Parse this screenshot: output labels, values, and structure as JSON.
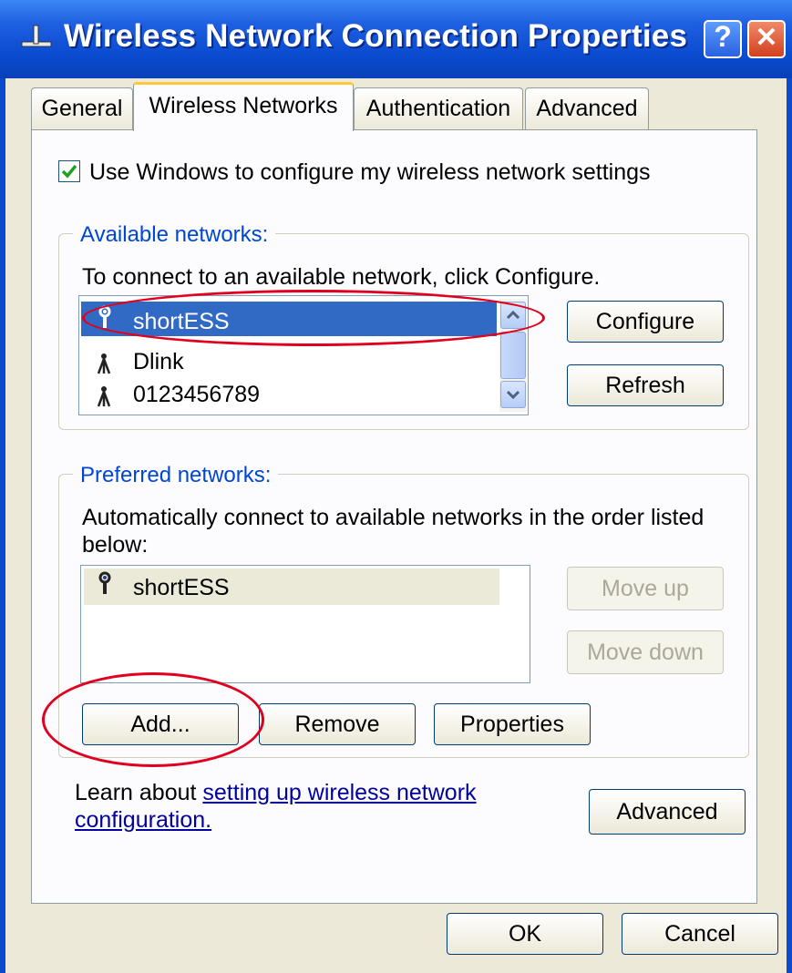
{
  "window": {
    "title": "Wireless Network Connection Properties",
    "help_glyph": "?",
    "close_glyph": "✕"
  },
  "tabs": [
    {
      "label": "General"
    },
    {
      "label": "Wireless Networks",
      "active": true
    },
    {
      "label": "Authentication"
    },
    {
      "label": "Advanced"
    }
  ],
  "use_windows": {
    "label": "Use Windows to configure my wireless network settings",
    "checked": true
  },
  "available": {
    "group_label": "Available networks:",
    "instruction": "To connect to an available network, click Configure.",
    "networks": [
      {
        "name": "shortESS",
        "icon": "wireless-infrastructure-icon",
        "selected": true
      },
      {
        "name": "Dlink",
        "icon": "antenna-icon"
      },
      {
        "name": "0123456789",
        "icon": "antenna-icon"
      }
    ],
    "configure_label": "Configure",
    "refresh_label": "Refresh"
  },
  "preferred": {
    "group_label": "Preferred networks:",
    "instruction_line1": "Automatically connect to available networks in the order listed",
    "instruction_line2": "below:",
    "networks": [
      {
        "name": "shortESS",
        "icon": "wireless-infrastructure-icon"
      }
    ],
    "move_up_label": "Move up",
    "move_down_label": "Move down",
    "add_label": "Add...",
    "remove_label": "Remove",
    "properties_label": "Properties"
  },
  "learn": {
    "prefix": "Learn about ",
    "link_line1": "setting up wireless network",
    "link_line2": "configuration."
  },
  "advanced_label": "Advanced",
  "footer": {
    "ok_label": "OK",
    "cancel_label": "Cancel"
  },
  "colors": {
    "titlebar": "#0a4bd0",
    "dialog_bg": "#ece9d8",
    "group_label": "#0046d5",
    "selection": "#316ac5",
    "annotation": "#e1001e"
  }
}
